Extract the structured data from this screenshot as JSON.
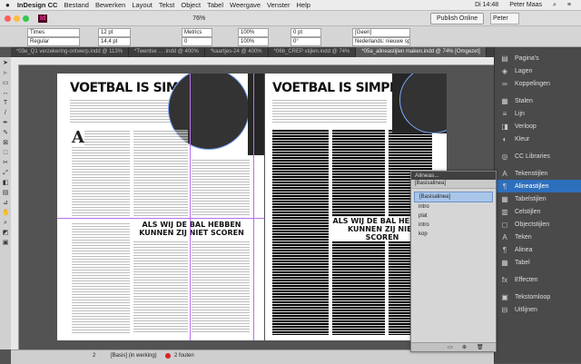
{
  "menubar": {
    "apple": "",
    "app": "InDesign CC",
    "items": [
      "Bestand",
      "Bewerken",
      "Layout",
      "Tekst",
      "Object",
      "Tabel",
      "Weergave",
      "Venster",
      "Help"
    ],
    "time": "Di 14:48",
    "user": "Peter Maas"
  },
  "appbar": {
    "logo": "Id",
    "zoom": "76%",
    "publish": "Publish Online",
    "user": "Peter"
  },
  "control": {
    "font": "Times",
    "style": "Regular",
    "size": "12 pt",
    "leading": "14,4 pt",
    "tracking": "0",
    "kerning": "Metrics",
    "scale_v": "100%",
    "scale_h": "100%",
    "baseline": "0 pt",
    "skew": "0°",
    "paragraph_style": "[Geen]",
    "language": "Nederlands: nieuwe spell..."
  },
  "tabs": [
    "*03e_Q1 verzekering-ontwerp.indd @ 113%",
    "*Twentse ... .indd @ 400%",
    "*kaartjes-24 @ 400%",
    "*06b_CREP stijlen.indd @ 74%",
    "*05a_alineastijlen maken.indd @ 74% [Omgezet]"
  ],
  "page_left": {
    "headline": "VOETBAL IS SIMPEL",
    "subhead": "ALS WIJ DE BAL HEBBEN KUNNEN ZIJ NIET SCOREN",
    "dropcap": "A"
  },
  "page_right": {
    "headline": "VOETBAL IS SIMPEL",
    "subhead": "ALS WIJ DE BAL HEBBEN KUNNEN ZIJ NIET SCOREN"
  },
  "statusbar": {
    "page": "2",
    "style": "[Basis] (in werking)",
    "errors": "2 fouten"
  },
  "right_panel": [
    {
      "icon": "pages-icon",
      "label": "Pagina's"
    },
    {
      "icon": "layers-icon",
      "label": "Lagen"
    },
    {
      "icon": "links-icon",
      "label": "Koppelingen"
    },
    {
      "icon": "strokes-icon",
      "label": "Stalen"
    },
    {
      "icon": "stroke-icon",
      "label": "Lijn"
    },
    {
      "icon": "gradient-icon",
      "label": "Verloop"
    },
    {
      "icon": "color-icon",
      "label": "Kleur"
    },
    {
      "icon": "cc-libraries-icon",
      "label": "CC Libraries"
    },
    {
      "icon": "character-styles-icon",
      "label": "Tekenstijlen"
    },
    {
      "icon": "paragraph-styles-icon",
      "label": "Alineastijlen"
    },
    {
      "icon": "table-styles-icon",
      "label": "Tabelstijlen"
    },
    {
      "icon": "cell-styles-icon",
      "label": "Celstijlen"
    },
    {
      "icon": "object-styles-icon",
      "label": "Objectstijlen"
    },
    {
      "icon": "character-icon",
      "label": "Teken"
    },
    {
      "icon": "paragraph-icon",
      "label": "Alinea"
    },
    {
      "icon": "table-icon",
      "label": "Tabel"
    },
    {
      "icon": "effects-icon",
      "label": "Effecten"
    },
    {
      "icon": "text-wrap-icon",
      "label": "Tekstomloop"
    },
    {
      "icon": "align-icon",
      "label": "Uitlijnen"
    }
  ],
  "float_panel": {
    "title": "Alineas...",
    "group": "[Basisalinea]",
    "items": [
      "[Basisalinea]",
      "intro",
      "plat",
      "intro",
      "kop"
    ]
  }
}
